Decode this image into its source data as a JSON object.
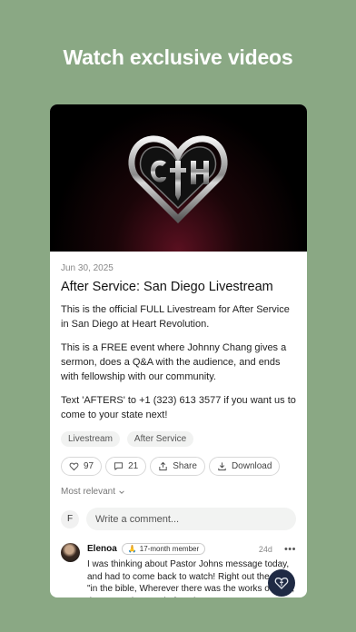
{
  "headline": "Watch exclusive videos",
  "post": {
    "date": "Jun 30, 2025",
    "title": "After Service: San Diego Livestream",
    "paragraphs": [
      "This is the official FULL Livestream for After Service in San Diego at Heart Revolution.",
      "This is a FREE event where Johnny Chang gives a sermon, does a Q&A with the audience, and ends with fellowship with our community.",
      "Text 'AFTERS' to +1 (323) 613 3577 if you want us to come to your state next!"
    ],
    "tags": [
      "Livestream",
      "After Service"
    ],
    "actions": {
      "likes": "97",
      "comments": "21",
      "share": "Share",
      "download": "Download"
    },
    "sort_label": "Most relevant",
    "comment_avatar_initial": "F",
    "comment_placeholder": "Write a comment...",
    "comment": {
      "name": "Elenoa",
      "badge": "17-month member",
      "badge_emoji": "🙏",
      "age": "24d",
      "more": "•••",
      "text": "I was thinking about Pastor Johns message today, and had to come back to watch! Right out the gate \"in the bible, Wherever there was the works of God, there was the Word of God\" Amen"
    }
  },
  "icons": {
    "hero": "heart-logo",
    "like": "heart-icon",
    "comment": "speech-bubble-icon",
    "share": "share-icon",
    "download": "download-icon",
    "sort": "chevron-down-icon",
    "fab": "heart-logo-icon"
  },
  "colors": {
    "background": "#8aa884",
    "fab": "#1f2a44"
  }
}
